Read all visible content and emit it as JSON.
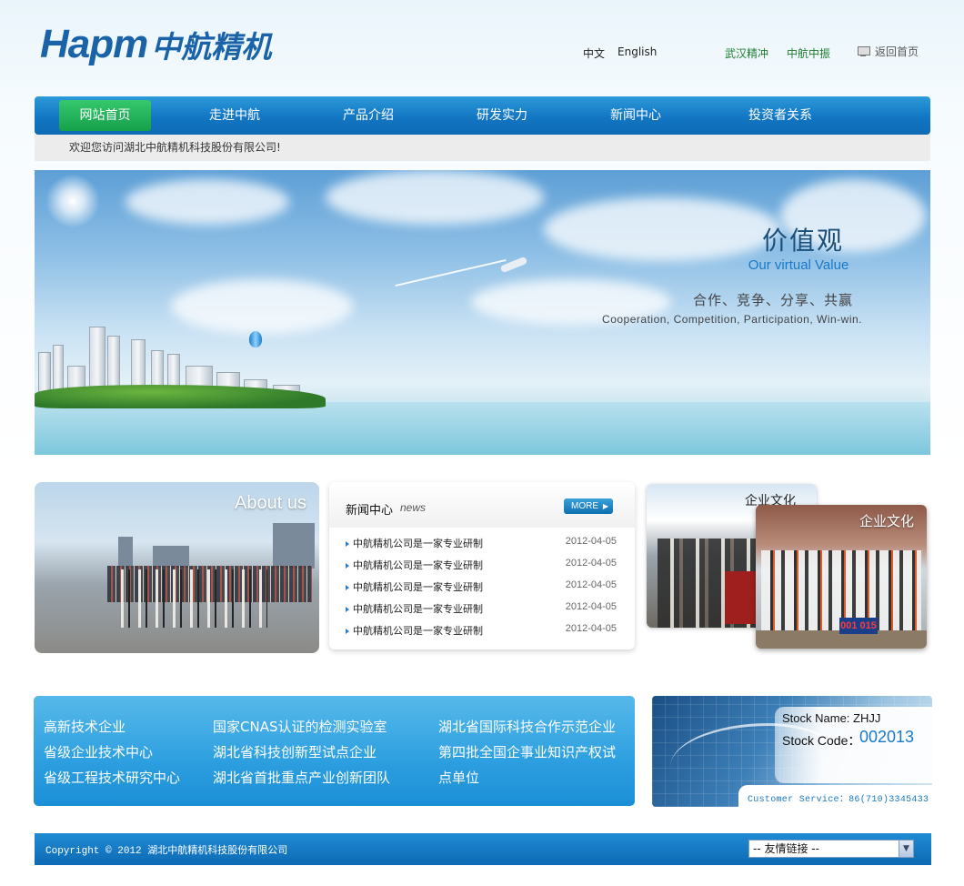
{
  "header": {
    "logo_en": "Hapm",
    "logo_cn": "中航精机",
    "lang_cn": "中文",
    "lang_en": "English",
    "sublink_1": "武汉精冲",
    "sublink_2": "中航中振",
    "home_link": "返回首页"
  },
  "nav": {
    "items": [
      {
        "label": "网站首页"
      },
      {
        "label": "走进中航"
      },
      {
        "label": "产品介绍"
      },
      {
        "label": "研发实力"
      },
      {
        "label": "新闻中心"
      },
      {
        "label": "投资者关系"
      }
    ]
  },
  "welcome": "欢迎您访问湖北中航精机科技股份有限公司!",
  "banner": {
    "title": "价值观",
    "subtitle": "Our virtual Value",
    "values_cn": "合作、竞争、分享、共赢",
    "values_en": "Cooperation, Competition, Participation, Win-win."
  },
  "about": {
    "title": "About us"
  },
  "news": {
    "title": "新闻中心",
    "title_en": "news",
    "more": "MORE",
    "items": [
      {
        "title": "中航精机公司是一家专业研制",
        "date": "2012-04-05"
      },
      {
        "title": "中航精机公司是一家专业研制",
        "date": "2012-04-05"
      },
      {
        "title": "中航精机公司是一家专业研制",
        "date": "2012-04-05"
      },
      {
        "title": "中航精机公司是一家专业研制",
        "date": "2012-04-05"
      },
      {
        "title": "中航精机公司是一家专业研制",
        "date": "2012-04-05"
      }
    ]
  },
  "culture": {
    "back_title": "企业文化",
    "front_title": "企业文化",
    "score": "001 015"
  },
  "honors": {
    "col1": [
      "高新技术企业",
      "省级企业技术中心",
      "省级工程技术研究中心"
    ],
    "col2": [
      "国家CNAS认证的检测实验室",
      "湖北省科技创新型试点企业",
      "湖北省首批重点产业创新团队"
    ],
    "col3": [
      "湖北省国际科技合作示范企业",
      "第四批全国企事业知识产权试",
      "点单位"
    ]
  },
  "stock": {
    "name": "Stock Name: ZHJJ",
    "code_label": "Stock Code：",
    "code": "002013",
    "service": "Customer Service：86(710)3345433"
  },
  "footer": {
    "copyright": "Copyright © 2012 湖北中航精机科技股份有限公司",
    "links_select": "-- 友情链接 --",
    "select_arrow": "▼"
  },
  "colors": {
    "brand_blue": "#1a63a8",
    "nav_blue": "#1276c4",
    "nav_active_green": "#16a04b",
    "link_green": "#1e7d2f",
    "accent_blue": "#1a79c6"
  }
}
